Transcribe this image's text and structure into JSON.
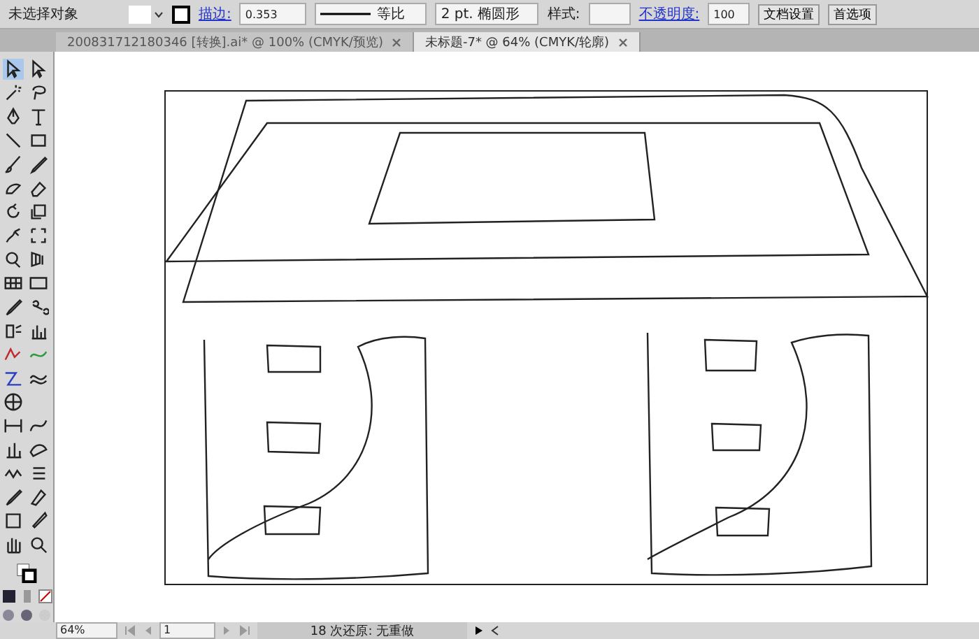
{
  "control_bar": {
    "selection_label": "未选择对象",
    "stroke_label": "描边:",
    "stroke_weight": "0.353",
    "stroke_profile": "等比",
    "brush": "2 pt. 椭圆形",
    "style_label": "样式:",
    "opacity_label": "不透明度:",
    "opacity_value": "100",
    "buttons": [
      "文档设置",
      "首选项"
    ]
  },
  "tabs": [
    {
      "label": "200831712180346 [转换].ai* @ 100% (CMYK/预览)",
      "selected": false
    },
    {
      "label": "未标题-7* @ 64% (CMYK/轮廓)",
      "selected": true
    }
  ],
  "status_bar": {
    "zoom": "64%",
    "page": "1",
    "message": "18 次还原: 无重做"
  }
}
